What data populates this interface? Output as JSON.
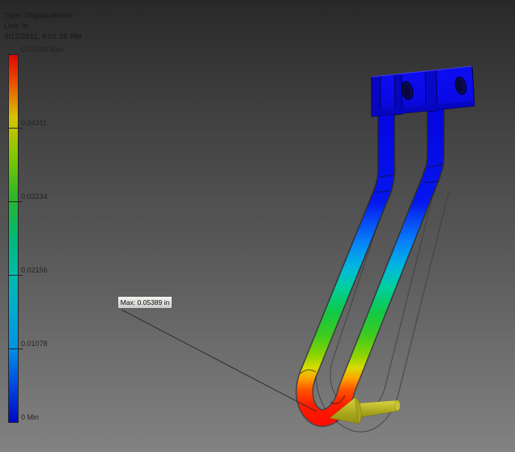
{
  "header": {
    "type": "Type: Displacement",
    "unit": "Unit: in",
    "timestamp": "9/12/2011, 6:01:36 PM"
  },
  "legend": {
    "labels": [
      "0.05389 Max",
      "0.04311",
      "0.03234",
      "0.02156",
      "0.01078",
      "0 Min"
    ],
    "gradient_colors_top_to_bottom": [
      "#e20400",
      "#e85400",
      "#d9c400",
      "#7cc800",
      "#2cb52c",
      "#00b877",
      "#00bcab",
      "#00aacf",
      "#0092e2",
      "#0048e0",
      "#0008c8"
    ]
  },
  "probe": {
    "max_annotation": "Max: 0.05389 in"
  },
  "model": {
    "bracket_color": "#0a0ae8",
    "hole_color": "#0c0c55",
    "load_arrow_color": "#b5b224",
    "wireframe_color": "#3e3e43",
    "displacement_gradient_top_to_bottom": [
      "#0505e0",
      "#0516ee",
      "#0782fa",
      "#00b8e0",
      "#00cfa0",
      "#10c948",
      "#3ecb1d",
      "#8ed400",
      "#d8dc00",
      "#ffa300",
      "#ff5500",
      "#ff1e00",
      "#ff0f00"
    ],
    "background_top": "#282828",
    "background_bottom": "#828282"
  }
}
